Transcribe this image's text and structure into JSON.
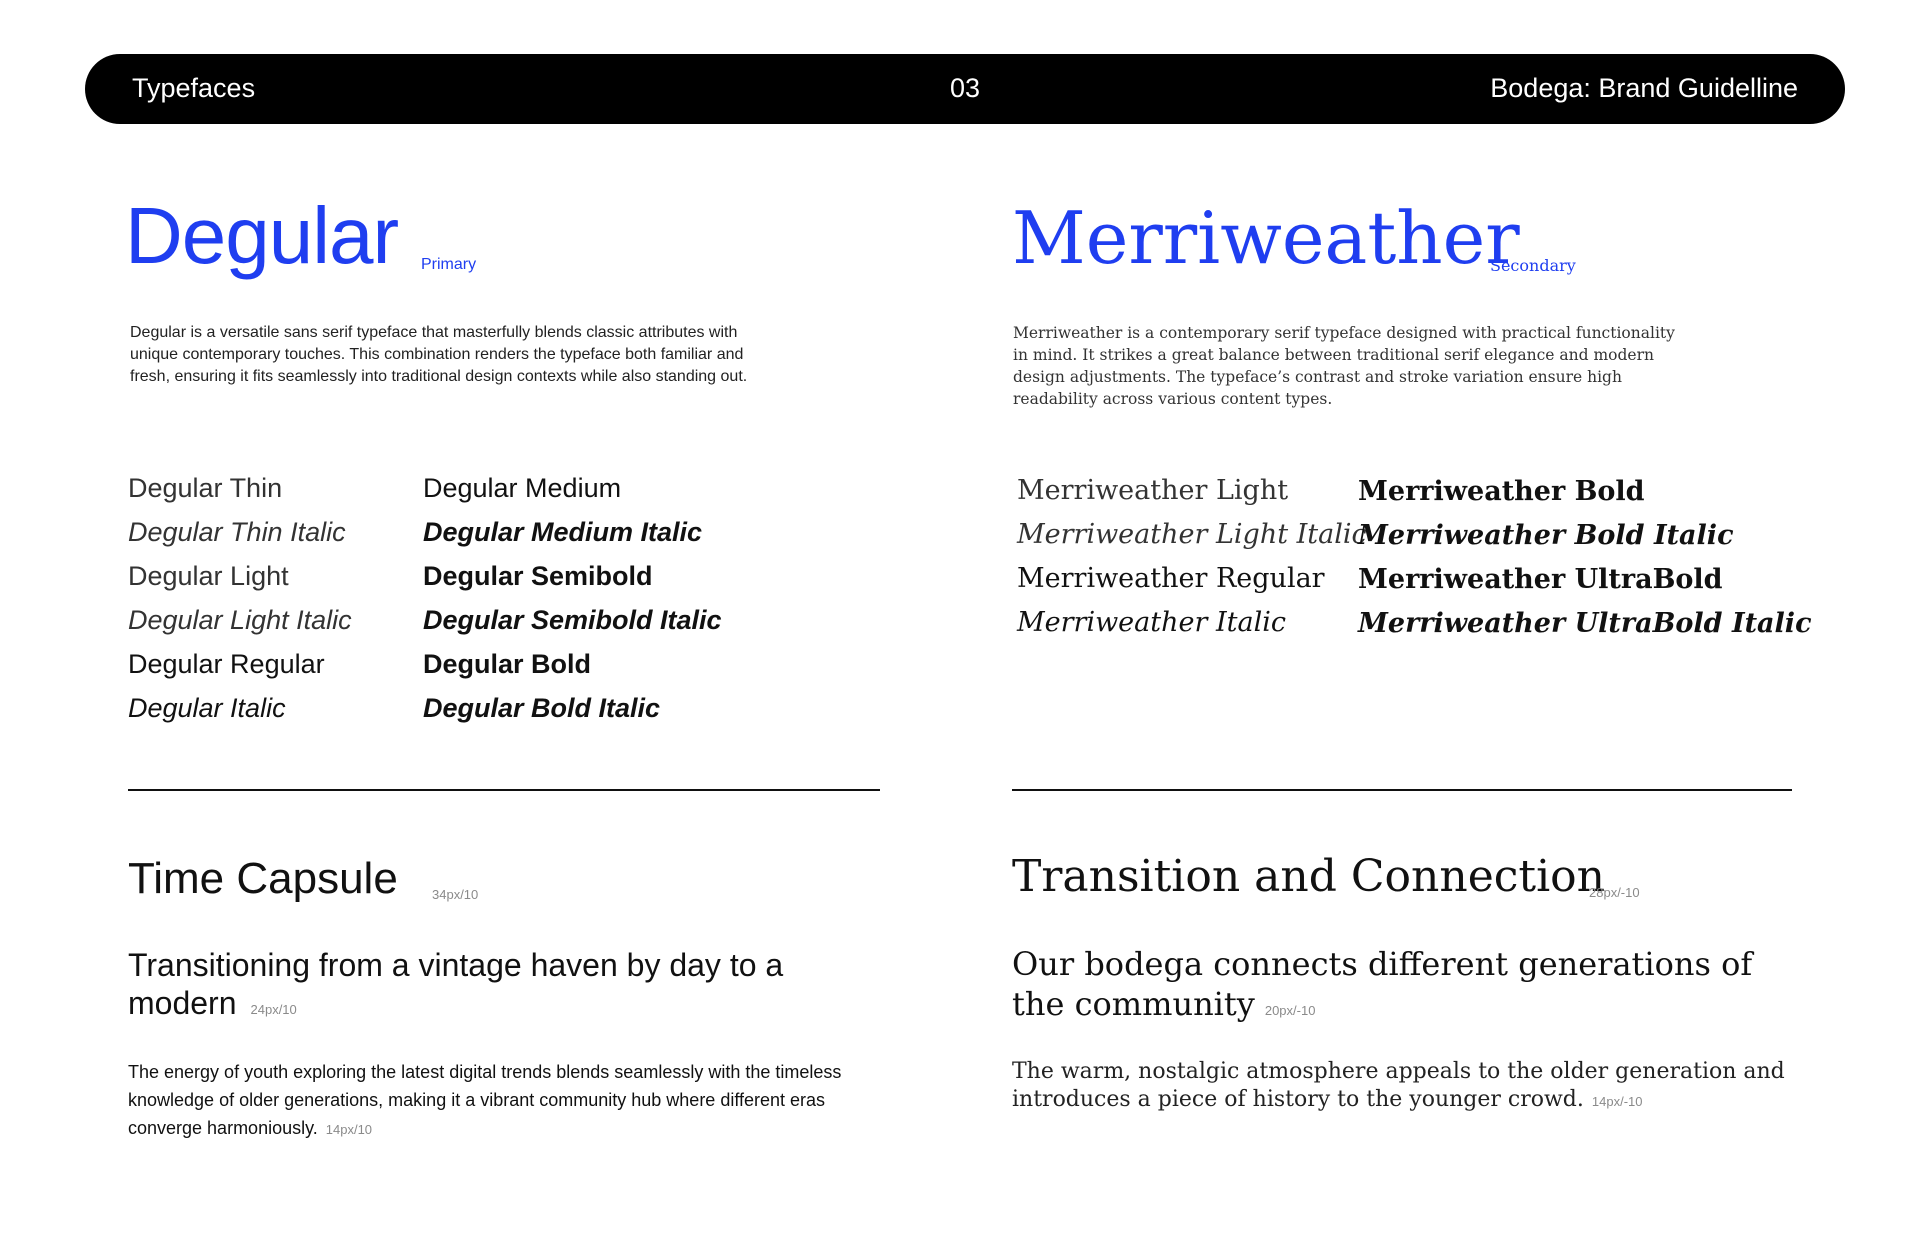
{
  "header": {
    "left": "Typefaces",
    "page_number": "03",
    "right": "Bodega: Brand Guidelline"
  },
  "colors": {
    "accent": "#1f3ef0",
    "text": "#111111",
    "muted": "#8a8a8a",
    "bar": "#000000"
  },
  "primary": {
    "name": "Degular",
    "tag": "Primary",
    "description": "Degular is a versatile sans serif typeface that masterfully blends classic attributes with unique contemporary touches. This combination renders the typeface both familiar and fresh, ensuring it fits seamlessly into traditional design contexts while also standing out.",
    "weights_col1": [
      "Degular Thin",
      "Degular Thin Italic",
      "Degular Light",
      "Degular Light Italic",
      "Degular Regular",
      "Degular Italic"
    ],
    "weights_col2": [
      "Degular Medium",
      "Degular Medium Italic",
      "Degular Semibold",
      "Degular Semibold Italic",
      "Degular Bold",
      "Degular Bold Italic"
    ],
    "sample_heading": "Time Capsule",
    "sample_heading_metric": "34px/10",
    "sample_subheading": "Transitioning from a vintage haven by day to a modern",
    "sample_subheading_metric": "24px/10",
    "sample_body": "The energy of youth exploring the latest digital trends blends seamlessly with the timeless knowledge of older generations, making it a vibrant community hub where different eras converge harmoniously.",
    "sample_body_metric": "14px/10"
  },
  "secondary": {
    "name": "Merriweather",
    "tag": "Secondary",
    "description": "Merriweather is a contemporary serif typeface designed with practical functionality in mind. It strikes a great balance between traditional serif elegance and modern design adjustments. The typeface’s contrast and stroke variation ensure high readability across various content types.",
    "weights_col1": [
      "Merriweather Light",
      "Merriweather Light Italic",
      "Merriweather Regular",
      "Merriweather Italic"
    ],
    "weights_col2": [
      "Merriweather Bold",
      "Merriweather Bold Italic",
      "Merriweather UltraBold",
      "Merriweather UltraBold Italic"
    ],
    "sample_heading": "Transition and Connection",
    "sample_heading_metric": "28px/-10",
    "sample_subheading": "Our bodega connects different generations of the community",
    "sample_subheading_metric": "20px/-10",
    "sample_body": "The warm, nostalgic atmosphere appeals to the older generation and introduces a piece of history to the younger crowd.",
    "sample_body_metric": "14px/-10"
  }
}
